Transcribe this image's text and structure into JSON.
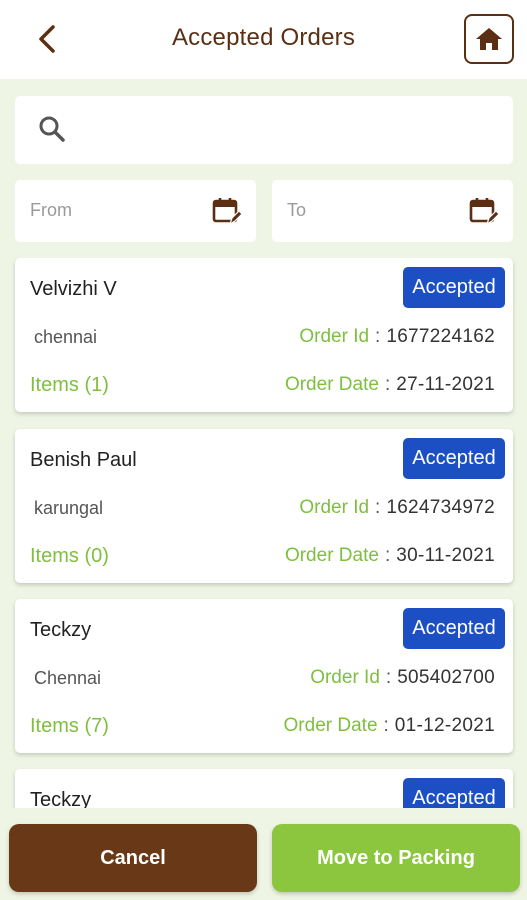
{
  "header": {
    "title": "Accepted Orders",
    "back_icon": "chevron-left-icon",
    "home_icon": "home-icon"
  },
  "search": {
    "value": "",
    "placeholder": ""
  },
  "filters": {
    "from_placeholder": "From",
    "to_placeholder": "To"
  },
  "labels": {
    "order_id": "Order Id",
    "order_date": "Order Date",
    "separator": ":"
  },
  "orders": [
    {
      "name": "Velvizhi V",
      "status": "Accepted",
      "city": "chennai",
      "items": "Items (1)",
      "order_id": "1677224162",
      "order_date": "27-11-2021"
    },
    {
      "name": "Benish Paul",
      "status": "Accepted",
      "city": "karungal",
      "items": "Items (0)",
      "order_id": "1624734972",
      "order_date": "30-11-2021"
    },
    {
      "name": "Teckzy",
      "status": "Accepted",
      "city": "Chennai",
      "items": "Items (7)",
      "order_id": "505402700",
      "order_date": "01-12-2021"
    },
    {
      "name": "Teckzy",
      "status": "Accepted"
    }
  ],
  "actions": {
    "cancel_label": "Cancel",
    "move_label": "Move to Packing"
  },
  "colors": {
    "brown": "#5a2f13",
    "green": "#7fbf3f",
    "badge_blue": "#1c4fc4",
    "background": "#eff5e4"
  }
}
